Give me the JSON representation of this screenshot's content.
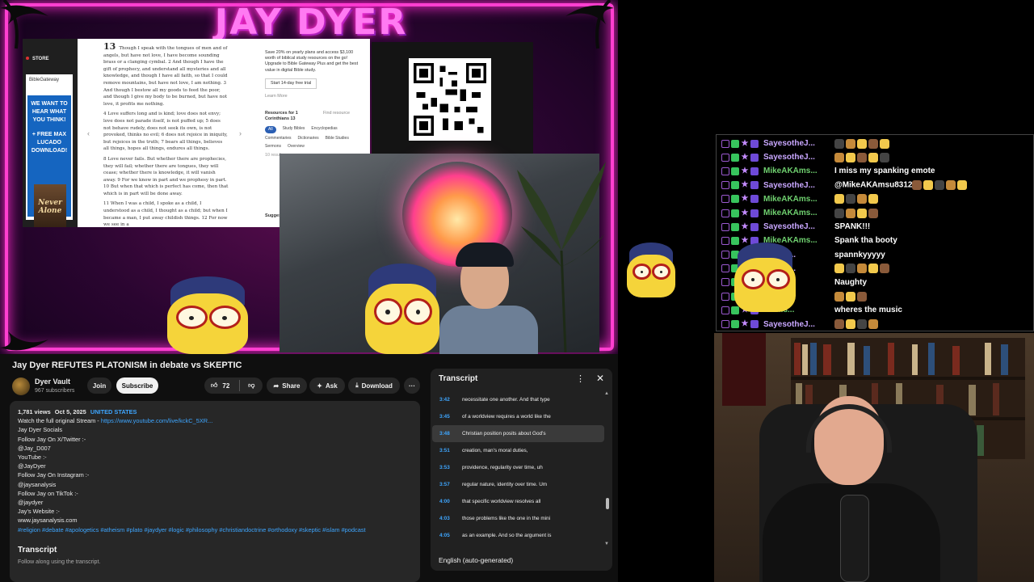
{
  "stream": {
    "overlay_title": "JAY DYER",
    "colors": {
      "neon": "#ff3fd0",
      "accent": "#3ea6ff"
    }
  },
  "bible": {
    "store_label": "STORE",
    "logo_label": "BibleGateway",
    "ad_text": "WE WANT TO HEAR WHAT YOU THINK!",
    "ad_offer": "+ FREE MAX LUCADO DOWNLOAD!",
    "book_title": "Never Alone",
    "chapter": "13",
    "verses": [
      "Though I speak with the tongues of men and of angels, but have not love, I have become sounding brass or a clanging cymbal. 2 And though I have the gift of prophecy, and understand all mysteries and all knowledge, and though I have all faith, so that I could remove mountains, but have not love, I am nothing. 3 And though I bestow all my goods to feed the poor, and though I give my body to be burned, but have not love, it profits me nothing.",
      "4 Love suffers long and is kind; love does not envy; love does not parade itself, is not puffed up; 5 does not behave rudely, does not seek its own, is not provoked, thinks no evil; 6 does not rejoice in iniquity, but rejoices in the truth; 7 bears all things, believes all things, hopes all things, endures all things.",
      "8 Love never fails. But whether there are prophecies, they will fail; whether there are tongues, they will cease; whether there is knowledge, it will vanish away. 9 For we know in part and we prophesy in part. 10 But when that which is perfect has come, then that which is in part will be done away.",
      "11 When I was a child, I spoke as a child, I understood as a child, I thought as a child; but when I became a man, I put away childish things. 12 For now we see in a"
    ],
    "promo": "Save 20% on yearly plans and access $3,100 worth of biblical study resources on the go! Upgrade to Bible Gateway Plus and get the best value in digital Bible study.",
    "trial_button": "Start 14-day free trial",
    "learn_more": "Learn More",
    "resources_for": "Resources for 1 Corinthians 13",
    "find_resource": "Find resource",
    "resource_chips": [
      "All",
      "Study Bibles",
      "Encyclopedias",
      "Commentaries",
      "Dictionaries",
      "Bible Studies",
      "Sermons",
      "Overview"
    ],
    "results": "10 results",
    "suggested": "Suggested Resources"
  },
  "video": {
    "title": "Jay Dyer REFUTES PLATONISM in debate vs SKEPTIC",
    "channel_name": "Dyer Vault",
    "subscribers": "967 subscribers",
    "join_label": "Join",
    "subscribe_label": "Subscribe",
    "like_count": "72",
    "share_label": "Share",
    "ask_label": "Ask",
    "download_label": "Download",
    "more_label": "···"
  },
  "description": {
    "views": "1,781 views",
    "date": "Oct 5, 2025",
    "country": "UNITED STATES",
    "lines": [
      {
        "text": "Watch the full original Stream - ",
        "link": "https://www.youtube.com/live/kckC_5XR..."
      },
      {
        "text": "Jay Dyer Socials"
      },
      {
        "text": " Follow Jay On X/Twitter :-"
      },
      {
        "text": "@Jay_D007"
      },
      {
        "text": "YouTube :-"
      },
      {
        "text": "@JayDyer"
      },
      {
        "text": "Follow Jay On Instagram :-"
      },
      {
        "text": "@jaysanalysis"
      },
      {
        "text": "Follow Jay on TikTok :-"
      },
      {
        "text": "@jaydyer"
      },
      {
        "text": "Jay's Website :-"
      },
      {
        "text": "www.jaysanalysis.com"
      }
    ],
    "tags": "#religion #debate #apologetics #atheism #plato #jaydyer #logic #philosophy #christiandoctrine #orthodoxy #skeptic #islam #podcast",
    "transcript_heading": "Transcript",
    "transcript_sub": "Follow along using the transcript."
  },
  "transcript": {
    "title": "Transcript",
    "language": "English (auto-generated)",
    "rows": [
      {
        "time": "3:42",
        "text": "necessitate one another. And that type"
      },
      {
        "time": "3:45",
        "text": "of a worldview requires a world like the"
      },
      {
        "time": "3:48",
        "text": "Christian position posits about God's"
      },
      {
        "time": "3:51",
        "text": "creation, man's moral duties,"
      },
      {
        "time": "3:53",
        "text": "providence, regularity over time, uh"
      },
      {
        "time": "3:57",
        "text": "regular nature, identity over time. Um"
      },
      {
        "time": "4:00",
        "text": "that specific worldview resolves all"
      },
      {
        "time": "4:03",
        "text": "those problems like the one in the mini"
      },
      {
        "time": "4:05",
        "text": "as an example. And so the argument is"
      }
    ],
    "active_index": 2
  },
  "chat": {
    "messages": [
      {
        "user": "SayesotheJ...",
        "color": "purple",
        "text": "",
        "emotes": 5
      },
      {
        "user": "SayesotheJ...",
        "color": "purple",
        "text": "",
        "emotes": 5
      },
      {
        "user": "MikeAKAms...",
        "color": "green",
        "text": "I miss my spanking emote",
        "emotes": 0
      },
      {
        "user": "SayesotheJ...",
        "color": "purple",
        "text": "@MikeAKAmsu8312",
        "emotes": 5
      },
      {
        "user": "MikeAKAms...",
        "color": "green",
        "text": "",
        "emotes": 4
      },
      {
        "user": "MikeAKAms...",
        "color": "green",
        "text": "",
        "emotes": 4
      },
      {
        "user": "SayesotheJ...",
        "color": "purple",
        "text": "SPANK!!!",
        "emotes": 0
      },
      {
        "user": "MikeAKAms...",
        "color": "green",
        "text": "Spank tha booty",
        "emotes": 0
      },
      {
        "user": "...the J...",
        "color": "purple",
        "text": "spannkyyyyy",
        "emotes": 0
      },
      {
        "user": "...the J...",
        "color": "purple",
        "text": "",
        "emotes": 5
      },
      {
        "user": "...Ams...",
        "color": "green",
        "text": "Naughty",
        "emotes": 0
      },
      {
        "user": "...Ams...",
        "color": "green",
        "text": "",
        "emotes": 3
      },
      {
        "user": "...Ams...",
        "color": "green",
        "text": "wheres the music",
        "emotes": 0
      },
      {
        "user": "SayesotheJ...",
        "color": "purple",
        "text": "",
        "emotes": 4
      }
    ]
  }
}
